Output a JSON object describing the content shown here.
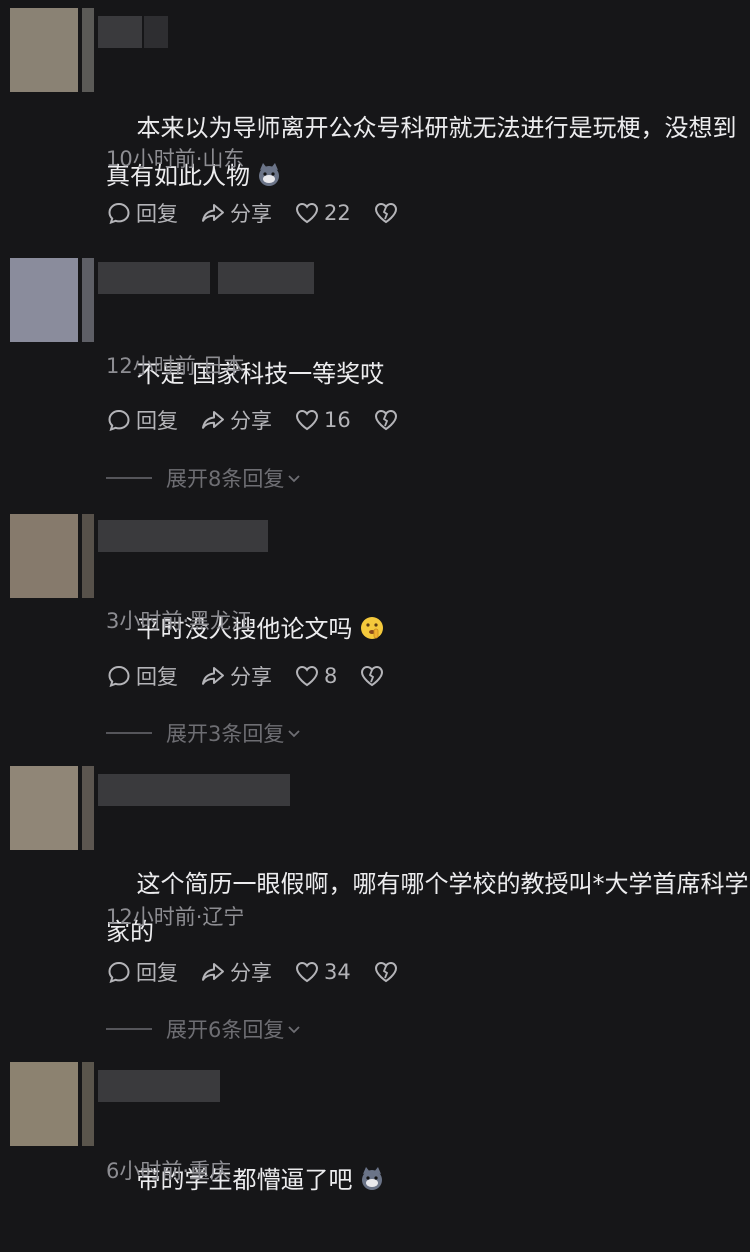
{
  "comments": [
    {
      "text": "本来以为导师离开公众号科研就无法进行是玩梗，没想到真有如此人物",
      "emoji": "cat-face-emoji",
      "meta": "10小时前·山东",
      "reply_label": "回复",
      "share_label": "分享",
      "likes": "22"
    },
    {
      "text": "不是 国家科技一等奖哎",
      "meta": "12小时前·日本",
      "reply_label": "回复",
      "share_label": "分享",
      "likes": "16",
      "expand_label": "展开8条回复"
    },
    {
      "text": "平时没人搜他论文吗",
      "emoji": "shushing-face-emoji",
      "meta": "3小时前·黑龙江",
      "reply_label": "回复",
      "share_label": "分享",
      "likes": "8",
      "expand_label": "展开3条回复"
    },
    {
      "text": "这个简历一眼假啊，哪有哪个学校的教授叫*大学首席科学家的",
      "meta": "12小时前·辽宁",
      "reply_label": "回复",
      "share_label": "分享",
      "likes": "34",
      "expand_label": "展开6条回复"
    },
    {
      "text": "带的学生都懵逼了吧",
      "emoji": "cat-face-emoji",
      "meta": "6小时前·重庆"
    }
  ],
  "colors": {
    "background": "#161618",
    "text": "#ececee",
    "meta": "#8d8d92",
    "actions": "#b4b4b8"
  }
}
